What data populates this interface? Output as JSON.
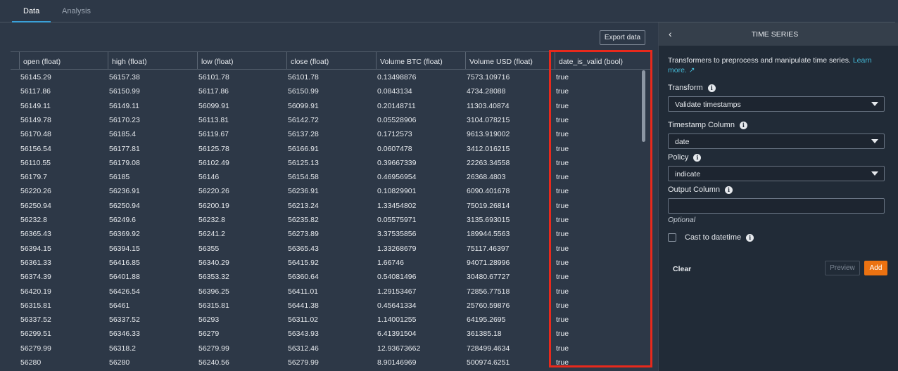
{
  "tabs": [
    {
      "label": "Data"
    },
    {
      "label": "Analysis"
    }
  ],
  "toolbar": {
    "export_label": "Export data"
  },
  "table": {
    "columns": [
      "open (float)",
      "high (float)",
      "low (float)",
      "close (float)",
      "Volume BTC (float)",
      "Volume USD (float)",
      "date_is_valid (bool)"
    ],
    "rows": [
      [
        "56145.29",
        "56157.38",
        "56101.78",
        "56101.78",
        "0.13498876",
        "7573.109716",
        "true"
      ],
      [
        "56117.86",
        "56150.99",
        "56117.86",
        "56150.99",
        "0.0843134",
        "4734.28088",
        "true"
      ],
      [
        "56149.11",
        "56149.11",
        "56099.91",
        "56099.91",
        "0.20148711",
        "11303.40874",
        "true"
      ],
      [
        "56149.78",
        "56170.23",
        "56113.81",
        "56142.72",
        "0.05528906",
        "3104.078215",
        "true"
      ],
      [
        "56170.48",
        "56185.4",
        "56119.67",
        "56137.28",
        "0.1712573",
        "9613.919002",
        "true"
      ],
      [
        "56156.54",
        "56177.81",
        "56125.78",
        "56166.91",
        "0.0607478",
        "3412.016215",
        "true"
      ],
      [
        "56110.55",
        "56179.08",
        "56102.49",
        "56125.13",
        "0.39667339",
        "22263.34558",
        "true"
      ],
      [
        "56179.7",
        "56185",
        "56146",
        "56154.58",
        "0.46956954",
        "26368.4803",
        "true"
      ],
      [
        "56220.26",
        "56236.91",
        "56220.26",
        "56236.91",
        "0.10829901",
        "6090.401678",
        "true"
      ],
      [
        "56250.94",
        "56250.94",
        "56200.19",
        "56213.24",
        "1.33454802",
        "75019.26814",
        "true"
      ],
      [
        "56232.8",
        "56249.6",
        "56232.8",
        "56235.82",
        "0.05575971",
        "3135.693015",
        "true"
      ],
      [
        "56365.43",
        "56369.92",
        "56241.2",
        "56273.89",
        "3.37535856",
        "189944.5563",
        "true"
      ],
      [
        "56394.15",
        "56394.15",
        "56355",
        "56365.43",
        "1.33268679",
        "75117.46397",
        "true"
      ],
      [
        "56361.33",
        "56416.85",
        "56340.29",
        "56415.92",
        "1.66746",
        "94071.28996",
        "true"
      ],
      [
        "56374.39",
        "56401.88",
        "56353.32",
        "56360.64",
        "0.54081496",
        "30480.67727",
        "true"
      ],
      [
        "56420.19",
        "56426.54",
        "56396.25",
        "56411.01",
        "1.29153467",
        "72856.77518",
        "true"
      ],
      [
        "56315.81",
        "56461",
        "56315.81",
        "56441.38",
        "0.45641334",
        "25760.59876",
        "true"
      ],
      [
        "56337.52",
        "56337.52",
        "56293",
        "56311.02",
        "1.14001255",
        "64195.2695",
        "true"
      ],
      [
        "56299.51",
        "56346.33",
        "56279",
        "56343.93",
        "6.41391504",
        "361385.18",
        "true"
      ],
      [
        "56279.99",
        "56318.2",
        "56279.99",
        "56312.46",
        "12.93673662",
        "728499.4634",
        "true"
      ],
      [
        "56280",
        "56280",
        "56240.56",
        "56279.99",
        "8.90146969",
        "500974.6251",
        "true"
      ]
    ]
  },
  "panel": {
    "title": "TIME SERIES",
    "description": "Transformers to preprocess and manipulate time series.",
    "learn_more": "Learn more.",
    "transform_label": "Transform",
    "transform_value": "Validate timestamps",
    "timestamp_label": "Timestamp Column",
    "timestamp_value": "date",
    "policy_label": "Policy",
    "policy_value": "indicate",
    "output_label": "Output Column",
    "output_value": "",
    "output_hint": "Optional",
    "cast_label": "Cast to datetime",
    "cast_checked": false,
    "clear_label": "Clear",
    "preview_label": "Preview",
    "add_label": "Add"
  },
  "colors": {
    "accent": "#ec7211",
    "highlight": "#e8291c",
    "link": "#44b9d6"
  }
}
